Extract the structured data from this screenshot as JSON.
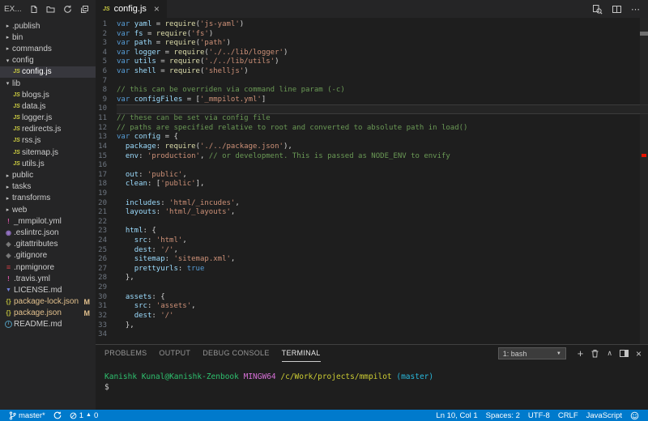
{
  "sidebar": {
    "title": "EX...",
    "header_icons": [
      "new-file",
      "new-folder",
      "refresh-explorer",
      "collapse-all"
    ],
    "items": [
      {
        "label": ".publish",
        "kind": "folder",
        "depth": 0,
        "expanded": false
      },
      {
        "label": "bin",
        "kind": "folder",
        "depth": 0,
        "expanded": false
      },
      {
        "label": "commands",
        "kind": "folder",
        "depth": 0,
        "expanded": false
      },
      {
        "label": "config",
        "kind": "folder",
        "depth": 0,
        "expanded": true
      },
      {
        "label": "config.js",
        "kind": "file",
        "icon": "js",
        "depth": 1,
        "selected": true
      },
      {
        "label": "lib",
        "kind": "folder",
        "depth": 0,
        "expanded": true
      },
      {
        "label": "blogs.js",
        "kind": "file",
        "icon": "js",
        "depth": 1
      },
      {
        "label": "data.js",
        "kind": "file",
        "icon": "js",
        "depth": 1
      },
      {
        "label": "logger.js",
        "kind": "file",
        "icon": "js",
        "depth": 1
      },
      {
        "label": "redirects.js",
        "kind": "file",
        "icon": "js",
        "depth": 1
      },
      {
        "label": "rss.js",
        "kind": "file",
        "icon": "js",
        "depth": 1
      },
      {
        "label": "sitemap.js",
        "kind": "file",
        "icon": "js",
        "depth": 1
      },
      {
        "label": "utils.js",
        "kind": "file",
        "icon": "js",
        "depth": 1
      },
      {
        "label": "public",
        "kind": "folder",
        "depth": 0,
        "expanded": false
      },
      {
        "label": "tasks",
        "kind": "folder",
        "depth": 0,
        "expanded": false
      },
      {
        "label": "transforms",
        "kind": "folder",
        "depth": 0,
        "expanded": false
      },
      {
        "label": "web",
        "kind": "folder",
        "depth": 0,
        "expanded": false
      },
      {
        "label": "_mmpilot.yml",
        "kind": "file",
        "icon": "yml",
        "depth": 0
      },
      {
        "label": ".eslintrc.json",
        "kind": "file",
        "icon": "eslint",
        "depth": 0
      },
      {
        "label": ".gitattributes",
        "kind": "file",
        "icon": "git",
        "depth": 0
      },
      {
        "label": ".gitignore",
        "kind": "file",
        "icon": "git",
        "depth": 0
      },
      {
        "label": ".npmignore",
        "kind": "file",
        "icon": "npm",
        "depth": 0
      },
      {
        "label": ".travis.yml",
        "kind": "file",
        "icon": "yml",
        "depth": 0
      },
      {
        "label": "LICENSE.md",
        "kind": "file",
        "icon": "license",
        "depth": 0
      },
      {
        "label": "package-lock.json",
        "kind": "file",
        "icon": "json",
        "depth": 0,
        "modified": true,
        "badge": "M"
      },
      {
        "label": "package.json",
        "kind": "file",
        "icon": "json",
        "depth": 0,
        "modified": true,
        "badge": "M"
      },
      {
        "label": "README.md",
        "kind": "file",
        "icon": "info",
        "depth": 0
      }
    ]
  },
  "file_icons": {
    "js": {
      "glyph": "JS",
      "color": "#cbcb41"
    },
    "yml": {
      "glyph": "!",
      "color": "#d553a3"
    },
    "eslint": {
      "glyph": "◉",
      "color": "#9573c6"
    },
    "git": {
      "glyph": "◈",
      "color": "#7d7d7d"
    },
    "npm": {
      "glyph": "≡",
      "color": "#cc3e44"
    },
    "json": {
      "glyph": "{}",
      "color": "#b7b73b"
    },
    "license": {
      "glyph": "▼",
      "color": "#6f7fd6"
    },
    "info": {
      "glyph": "i",
      "color": "#519aba",
      "circled": true
    }
  },
  "glyphs": {
    "chevron_down": "▾",
    "chevron_right": "▸"
  },
  "editor": {
    "tab": {
      "icon_text": "JS",
      "label": "config.js",
      "close": "×"
    },
    "title_icons": [
      "open-changes",
      "split-editor",
      "more-actions"
    ],
    "current_line": 10,
    "lines": [
      [
        [
          "kw",
          "var "
        ],
        [
          "var",
          "yaml"
        ],
        [
          "pn",
          " = "
        ],
        [
          "fn",
          "require"
        ],
        [
          "pn",
          "("
        ],
        [
          "str",
          "'js-yaml'"
        ],
        [
          "pn",
          ")"
        ]
      ],
      [
        [
          "kw",
          "var "
        ],
        [
          "var",
          "fs"
        ],
        [
          "pn",
          " = "
        ],
        [
          "fn",
          "require"
        ],
        [
          "pn",
          "("
        ],
        [
          "str",
          "'fs'"
        ],
        [
          "pn",
          ")"
        ]
      ],
      [
        [
          "kw",
          "var "
        ],
        [
          "var",
          "path"
        ],
        [
          "pn",
          " = "
        ],
        [
          "fn",
          "require"
        ],
        [
          "pn",
          "("
        ],
        [
          "str",
          "'path'"
        ],
        [
          "pn",
          ")"
        ]
      ],
      [
        [
          "kw",
          "var "
        ],
        [
          "var",
          "logger"
        ],
        [
          "pn",
          " = "
        ],
        [
          "fn",
          "require"
        ],
        [
          "pn",
          "("
        ],
        [
          "str",
          "'./../lib/logger'"
        ],
        [
          "pn",
          ")"
        ]
      ],
      [
        [
          "kw",
          "var "
        ],
        [
          "var",
          "utils"
        ],
        [
          "pn",
          " = "
        ],
        [
          "fn",
          "require"
        ],
        [
          "pn",
          "("
        ],
        [
          "str",
          "'./../lib/utils'"
        ],
        [
          "pn",
          ")"
        ]
      ],
      [
        [
          "kw",
          "var "
        ],
        [
          "var",
          "shell"
        ],
        [
          "pn",
          " = "
        ],
        [
          "fn",
          "require"
        ],
        [
          "pn",
          "("
        ],
        [
          "str",
          "'shelljs'"
        ],
        [
          "pn",
          ")"
        ]
      ],
      [],
      [
        [
          "cm",
          "// this can be overriden via command line param (-c)"
        ]
      ],
      [
        [
          "kw",
          "var "
        ],
        [
          "var",
          "configFiles"
        ],
        [
          "pn",
          " = ["
        ],
        [
          "str",
          "'_mmpilot.yml'"
        ],
        [
          "pn",
          "]"
        ]
      ],
      [],
      [
        [
          "cm",
          "// these can be set via config file"
        ]
      ],
      [
        [
          "cm",
          "// paths are specified relative to root and converted to absolute path in load()"
        ]
      ],
      [
        [
          "kw",
          "var "
        ],
        [
          "var",
          "config"
        ],
        [
          "pn",
          " = {"
        ]
      ],
      [
        [
          "pn",
          "  "
        ],
        [
          "var",
          "package"
        ],
        [
          "pn",
          ": "
        ],
        [
          "fn",
          "require"
        ],
        [
          "pn",
          "("
        ],
        [
          "str",
          "'./../package.json'"
        ],
        [
          "pn",
          "),"
        ]
      ],
      [
        [
          "pn",
          "  "
        ],
        [
          "var",
          "env"
        ],
        [
          "pn",
          ": "
        ],
        [
          "str",
          "'production'"
        ],
        [
          "pn",
          ", "
        ],
        [
          "cm",
          "// or development. This is passed as NODE_ENV to envify"
        ]
      ],
      [],
      [
        [
          "pn",
          "  "
        ],
        [
          "var",
          "out"
        ],
        [
          "pn",
          ": "
        ],
        [
          "str",
          "'public'"
        ],
        [
          "pn",
          ","
        ]
      ],
      [
        [
          "pn",
          "  "
        ],
        [
          "var",
          "clean"
        ],
        [
          "pn",
          ": ["
        ],
        [
          "str",
          "'public'"
        ],
        [
          "pn",
          "],"
        ]
      ],
      [],
      [
        [
          "pn",
          "  "
        ],
        [
          "var",
          "includes"
        ],
        [
          "pn",
          ": "
        ],
        [
          "str",
          "'html/_incudes'"
        ],
        [
          "pn",
          ","
        ]
      ],
      [
        [
          "pn",
          "  "
        ],
        [
          "var",
          "layouts"
        ],
        [
          "pn",
          ": "
        ],
        [
          "str",
          "'html/_layouts'"
        ],
        [
          "pn",
          ","
        ]
      ],
      [],
      [
        [
          "pn",
          "  "
        ],
        [
          "var",
          "html"
        ],
        [
          "pn",
          ": {"
        ]
      ],
      [
        [
          "pn",
          "    "
        ],
        [
          "var",
          "src"
        ],
        [
          "pn",
          ": "
        ],
        [
          "str",
          "'html'"
        ],
        [
          "pn",
          ","
        ]
      ],
      [
        [
          "pn",
          "    "
        ],
        [
          "var",
          "dest"
        ],
        [
          "pn",
          ": "
        ],
        [
          "str",
          "'/'"
        ],
        [
          "pn",
          ","
        ]
      ],
      [
        [
          "pn",
          "    "
        ],
        [
          "var",
          "sitemap"
        ],
        [
          "pn",
          ": "
        ],
        [
          "str",
          "'sitemap.xml'"
        ],
        [
          "pn",
          ","
        ]
      ],
      [
        [
          "pn",
          "    "
        ],
        [
          "var",
          "prettyurls"
        ],
        [
          "pn",
          ": "
        ],
        [
          "kw",
          "true"
        ]
      ],
      [
        [
          "pn",
          "  },"
        ]
      ],
      [],
      [
        [
          "pn",
          "  "
        ],
        [
          "var",
          "assets"
        ],
        [
          "pn",
          ": {"
        ]
      ],
      [
        [
          "pn",
          "    "
        ],
        [
          "var",
          "src"
        ],
        [
          "pn",
          ": "
        ],
        [
          "str",
          "'assets'"
        ],
        [
          "pn",
          ","
        ]
      ],
      [
        [
          "pn",
          "    "
        ],
        [
          "var",
          "dest"
        ],
        [
          "pn",
          ": "
        ],
        [
          "str",
          "'/'"
        ]
      ],
      [
        [
          "pn",
          "  },"
        ]
      ],
      []
    ]
  },
  "panel": {
    "tabs": [
      "PROBLEMS",
      "OUTPUT",
      "DEBUG CONSOLE",
      "TERMINAL"
    ],
    "active_tab": "TERMINAL",
    "terminal_select": "1: bash",
    "action_icons": [
      "new-terminal",
      "kill-terminal",
      "maximize-panel",
      "split-panel",
      "close-panel"
    ],
    "prompt_tokens": [
      [
        "green",
        "Kanishk Kunal@Kanishk-Zenbook "
      ],
      [
        "magenta",
        "MINGW64 "
      ],
      [
        "yellow",
        "/c/Work/projects/mmpilot "
      ],
      [
        "cyan",
        "(master)"
      ]
    ],
    "prompt_line2": "$"
  },
  "statusbar": {
    "branch": "master*",
    "errors": "1",
    "warnings": "0",
    "line_col": "Ln 10, Col 1",
    "indent": "Spaces: 2",
    "encoding": "UTF-8",
    "eol": "CRLF",
    "language": "JavaScript"
  },
  "colors": {
    "tokens": {
      "kw": "#569cd6",
      "var": "#9cdcfe",
      "fn": "#dcdcaa",
      "str": "#ce9178",
      "cm": "#6a9955",
      "pn": "#d4d4d4"
    },
    "terminal": {
      "green": "#2ec06e",
      "magenta": "#d670d6",
      "yellow": "#cccc33",
      "cyan": "#29b8db",
      "fg": "#cccccc"
    },
    "git_modified": "#e2c08d",
    "error_marker": "#e51400",
    "statusbar_bg": "#007acc",
    "sidebar_bg": "#252526",
    "editor_bg": "#1e1e1e",
    "selection_bg": "#37373d"
  }
}
